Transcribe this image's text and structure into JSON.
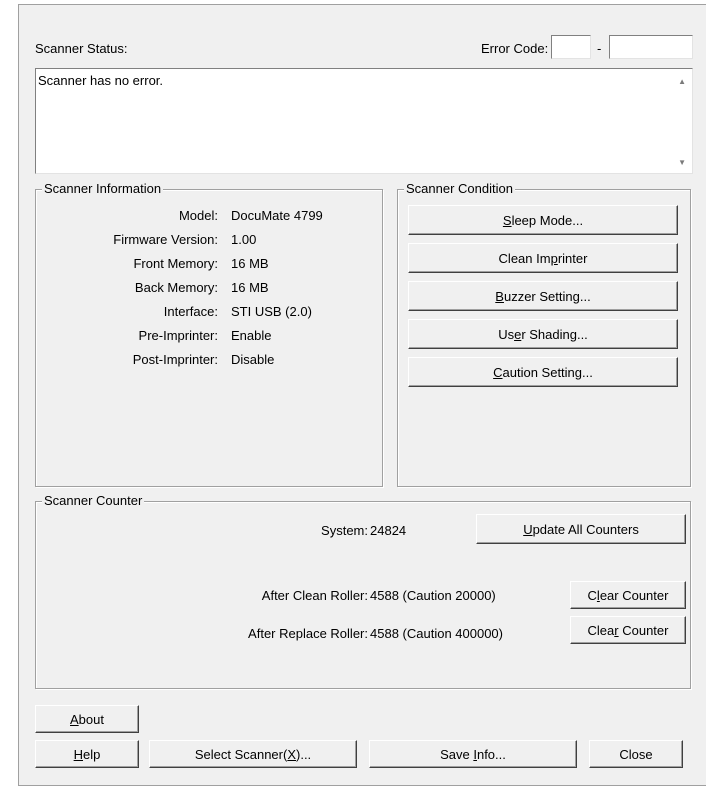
{
  "status": {
    "label": "Scanner Status:",
    "error_code_label": "Error Code:",
    "error_code_a": "",
    "error_code_b": "",
    "dash": "-",
    "message": "Scanner has no error."
  },
  "info": {
    "title": "Scanner Information",
    "rows": [
      {
        "label": "Model:",
        "value": "DocuMate 4799"
      },
      {
        "label": "Firmware Version:",
        "value": "1.00"
      },
      {
        "label": "Front Memory:",
        "value": "16 MB"
      },
      {
        "label": "Back Memory:",
        "value": "16 MB"
      },
      {
        "label": "Interface:",
        "value": "STI USB (2.0)"
      },
      {
        "label": "Pre-Imprinter:",
        "value": "Enable"
      },
      {
        "label": "Post-Imprinter:",
        "value": "Disable"
      }
    ]
  },
  "condition": {
    "title": "Scanner Condition",
    "buttons": [
      {
        "pre": "",
        "key": "S",
        "post": "leep Mode..."
      },
      {
        "pre": "Clean Im",
        "key": "p",
        "post": "rinter"
      },
      {
        "pre": "",
        "key": "B",
        "post": "uzzer Setting..."
      },
      {
        "pre": "Us",
        "key": "e",
        "post": "r Shading..."
      },
      {
        "pre": "",
        "key": "C",
        "post": "aution Setting..."
      }
    ]
  },
  "counter": {
    "title": "Scanner Counter",
    "system_label": "System:",
    "system_value": "24824",
    "update_btn": {
      "pre": "",
      "key": "U",
      "post": "pdate All Counters"
    },
    "clean_label": "After Clean Roller:",
    "clean_value": "4588 (Caution 20000)",
    "replace_label": "After Replace Roller:",
    "replace_value": "4588 (Caution 400000)",
    "clear1": {
      "pre": "C",
      "key": "l",
      "post": "ear Counter"
    },
    "clear2": {
      "pre": "Clea",
      "key": "r",
      "post": " Counter"
    }
  },
  "footer": {
    "about": {
      "pre": "",
      "key": "A",
      "post": "bout"
    },
    "help": {
      "pre": "",
      "key": "H",
      "post": "elp"
    },
    "select": {
      "pre": "Select Scanner(",
      "key": "X",
      "post": ")..."
    },
    "save": {
      "pre": "Save ",
      "key": "I",
      "post": "nfo..."
    },
    "close": {
      "pre": "",
      "key": "",
      "post": "Close"
    }
  }
}
